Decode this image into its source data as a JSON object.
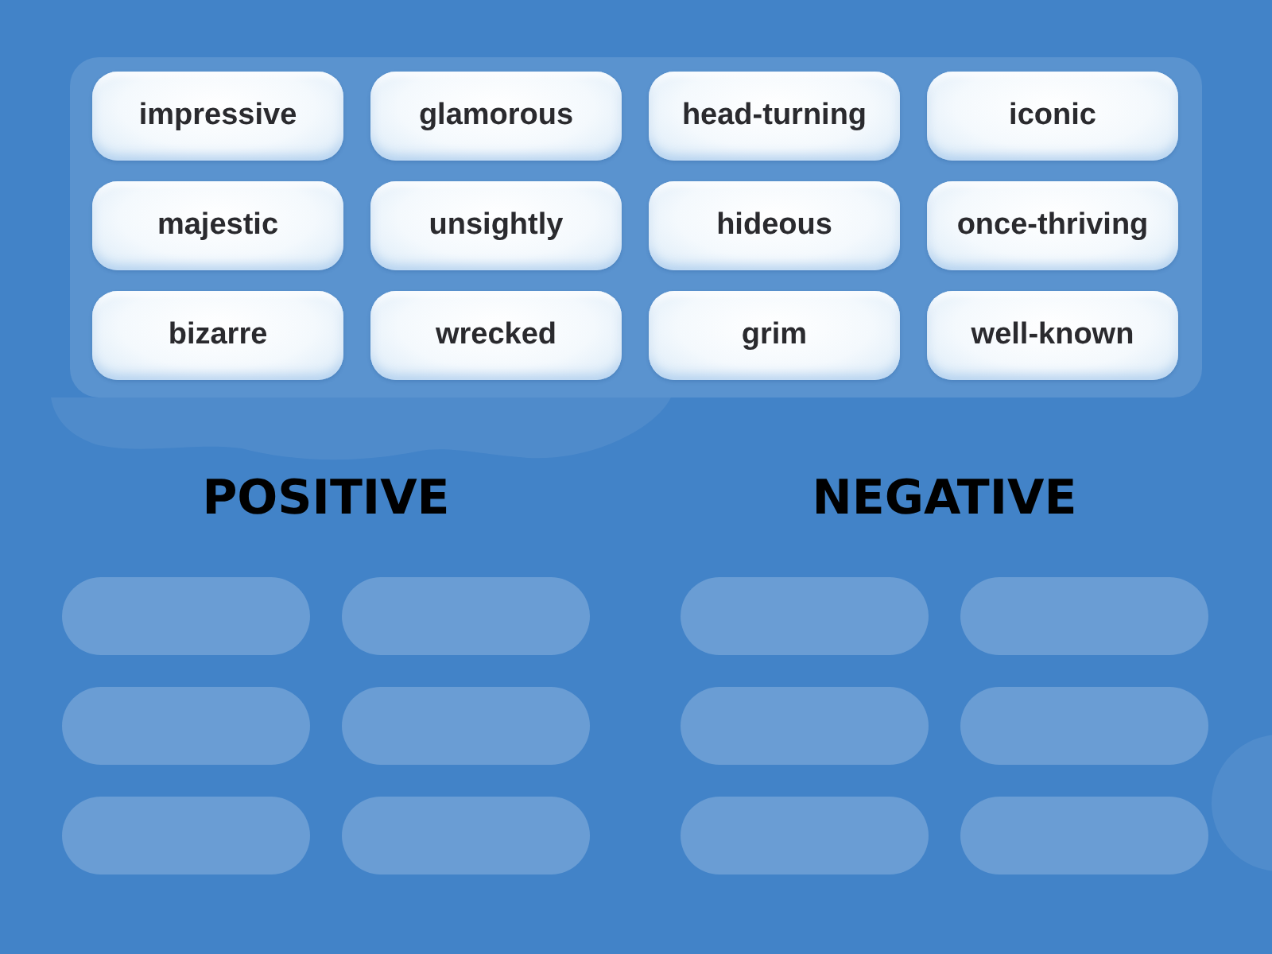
{
  "word_bank": {
    "words": [
      "impressive",
      "glamorous",
      "head-turning",
      "iconic",
      "majestic",
      "unsightly",
      "hideous",
      "once-thriving",
      "bizarre",
      "wrecked",
      "grim",
      "well-known"
    ]
  },
  "groups": [
    {
      "heading": "POSITIVE",
      "slots": [
        {
          "kind": "empty"
        },
        {
          "kind": "empty"
        },
        {
          "kind": "empty"
        },
        {
          "kind": "empty"
        },
        {
          "kind": "empty"
        },
        {
          "kind": "empty"
        }
      ]
    },
    {
      "heading": "NEGATIVE",
      "slots": [
        {
          "kind": "empty"
        },
        {
          "kind": "empty"
        },
        {
          "kind": "empty"
        },
        {
          "kind": "empty"
        },
        {
          "kind": "empty"
        },
        {
          "kind": "empty"
        }
      ]
    }
  ]
}
